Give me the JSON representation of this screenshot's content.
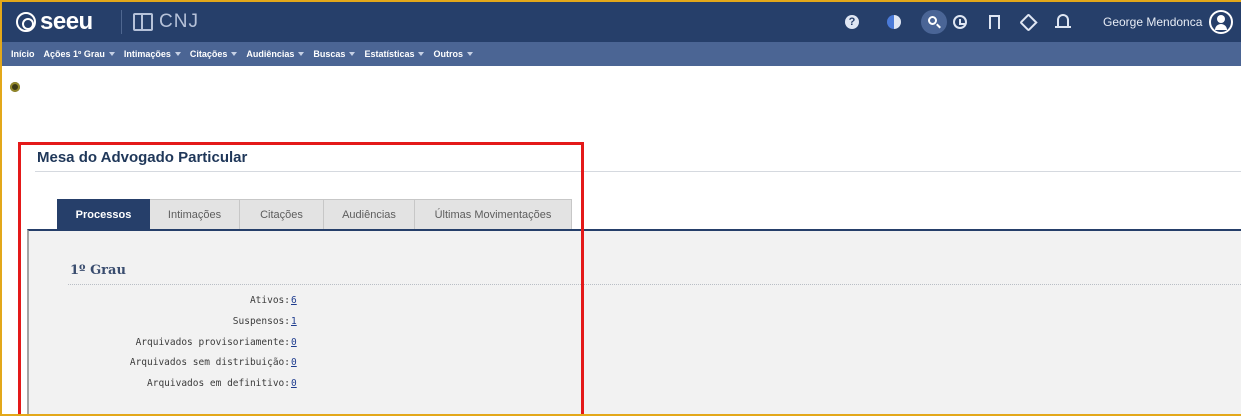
{
  "header": {
    "logo_text": "seeu",
    "partner_text": "CNJ",
    "icons": [
      "help-icon",
      "contrast-icon",
      "search-icon",
      "history-icon",
      "bookmark-icon",
      "tag-icon",
      "bell-icon",
      "user-avatar-icon"
    ],
    "user_name": "George Mendonca"
  },
  "menu": {
    "items": [
      {
        "label": "Início",
        "has_caret": false
      },
      {
        "label": "Ações 1º Grau",
        "has_caret": true
      },
      {
        "label": "Intimações",
        "has_caret": true
      },
      {
        "label": "Citações",
        "has_caret": true
      },
      {
        "label": "Audiências",
        "has_caret": true
      },
      {
        "label": "Buscas",
        "has_caret": true
      },
      {
        "label": "Estatísticas",
        "has_caret": true
      },
      {
        "label": "Outros",
        "has_caret": true
      }
    ]
  },
  "page": {
    "title": "Mesa do Advogado Particular",
    "tabs": [
      {
        "label": "Processos",
        "active": true
      },
      {
        "label": "Intimações",
        "active": false
      },
      {
        "label": "Citações",
        "active": false
      },
      {
        "label": "Audiências",
        "active": false
      },
      {
        "label": "Últimas Movimentações",
        "active": false
      }
    ],
    "section_title": "1º Grau",
    "stats": [
      {
        "label": "Ativos:",
        "value": "6"
      },
      {
        "label": "Suspensos:",
        "value": "1"
      },
      {
        "label": "Arquivados provisoriamente:",
        "value": "0"
      },
      {
        "label": "Arquivados sem distribuição:",
        "value": "0"
      },
      {
        "label": "Arquivados em definitivo:",
        "value": "0"
      }
    ]
  },
  "colors": {
    "topbar": "#263f6a",
    "menubar": "#4b6594",
    "active_tab": "#263f6a",
    "link": "#1f3d8f",
    "highlight": "#e41919",
    "frame": "#e3a81a"
  }
}
